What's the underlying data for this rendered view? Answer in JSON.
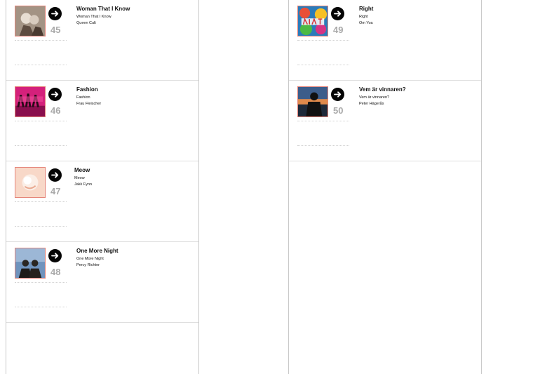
{
  "columns": [
    {
      "entries": [
        {
          "rank": "45",
          "title": "Woman That I Know",
          "song": "Woman That I Know",
          "artist": "Queen Cult",
          "cover_icon": "album-cover-icon"
        },
        {
          "rank": "46",
          "title": "Fashion",
          "song": "Fashion",
          "artist": "Frau Fleischer",
          "cover_icon": "album-cover-icon"
        },
        {
          "rank": "47",
          "title": "Meow",
          "song": "Meow",
          "artist": "Jakk Fynn",
          "cover_icon": "album-cover-icon"
        },
        {
          "rank": "48",
          "title": "One More Night",
          "song": "One More Night",
          "artist": "Percy Richter",
          "cover_icon": "album-cover-icon"
        }
      ]
    },
    {
      "entries": [
        {
          "rank": "49",
          "title": "Right",
          "song": "Right",
          "artist": "Om Yoa",
          "cover_icon": "album-cover-icon"
        },
        {
          "rank": "50",
          "title": "Vem är vinnaren?",
          "song": "Vem är vinnaren?",
          "artist": "Peter Hägerås",
          "cover_icon": "album-cover-icon"
        }
      ]
    }
  ],
  "colors": {
    "cover_border": "#e5857a",
    "rank": "#a9a9a9",
    "divider": "#dedede",
    "go_button": "#050505"
  },
  "icons": {
    "go": "arrow-right-circle-icon"
  }
}
